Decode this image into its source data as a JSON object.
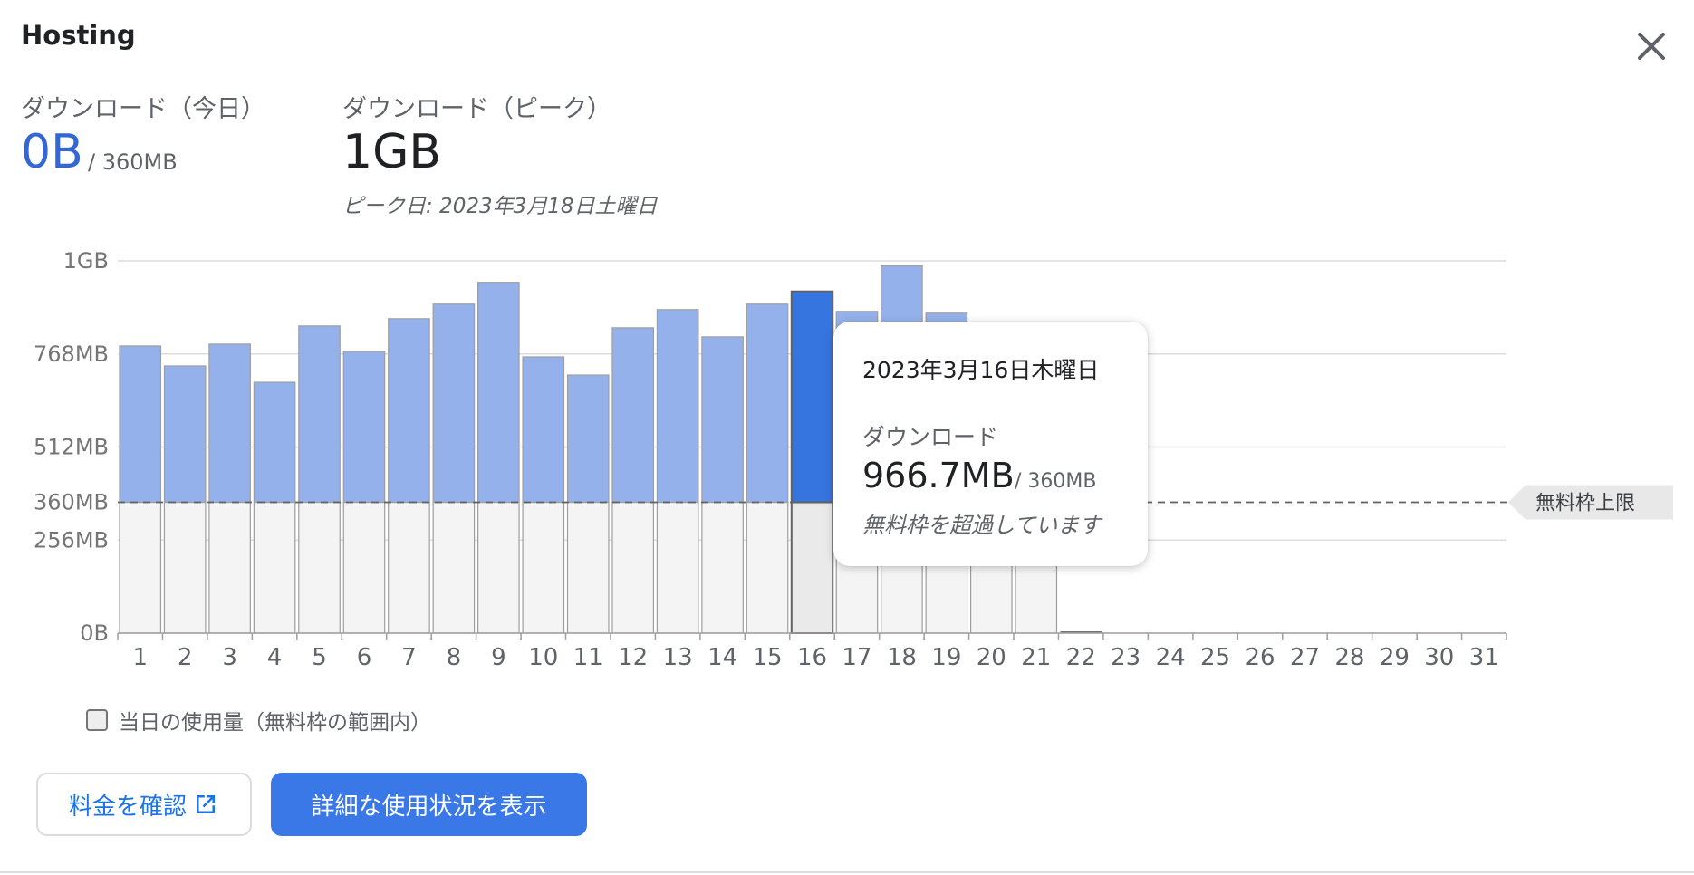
{
  "dialog": {
    "title": "Hosting",
    "close_icon": "close-icon"
  },
  "stats": {
    "today": {
      "label": "ダウンロード（今日）",
      "value": "0B",
      "quota": "/ 360MB",
      "color": "#3367d6"
    },
    "peak": {
      "label": "ダウンロード（ピーク）",
      "value": "1GB",
      "peak_date": "ピーク日: 2023年3月18日土曜日"
    }
  },
  "chart_data": {
    "type": "bar",
    "categories": [
      "1",
      "2",
      "3",
      "4",
      "5",
      "6",
      "7",
      "8",
      "9",
      "10",
      "11",
      "12",
      "13",
      "14",
      "15",
      "16",
      "17",
      "18",
      "19",
      "20",
      "21",
      "22",
      "23",
      "24",
      "25",
      "26",
      "27",
      "28",
      "29",
      "30",
      "31"
    ],
    "unit": "MB",
    "values": [
      790,
      735,
      795,
      690,
      845,
      775,
      865,
      905,
      965,
      760,
      710,
      840,
      890,
      815,
      905,
      940,
      885,
      1010,
      880,
      840,
      780,
      0,
      null,
      null,
      null,
      null,
      null,
      null,
      null,
      null,
      null
    ],
    "y_ticks": [
      {
        "label": "0B",
        "value": 0
      },
      {
        "label": "256MB",
        "value": 256
      },
      {
        "label": "360MB",
        "value": 360
      },
      {
        "label": "512MB",
        "value": 512
      },
      {
        "label": "768MB",
        "value": 768
      },
      {
        "label": "1GB",
        "value": 1024
      }
    ],
    "ylim": [
      0,
      1024
    ],
    "free_limit": 360,
    "free_limit_label": "無料枠上限",
    "highlighted_index": 15,
    "colors": {
      "over_limit": "#94b1eb",
      "over_limit_highlight": "#3674e0",
      "within_limit": "#f4f4f4",
      "within_limit_highlight": "#eaeaea",
      "bar_border": "#9e9e9e",
      "highlight_border": "#616161",
      "gridline": "#dadce0"
    },
    "grid": true
  },
  "tooltip": {
    "date": "2023年3月16日木曜日",
    "label": "ダウンロード",
    "value": "966.7MB",
    "quota": "/ 360MB",
    "note": "無料枠を超過しています"
  },
  "legend": {
    "label": "当日の使用量（無料枠の範囲内）"
  },
  "buttons": {
    "billing_label": "料金を確認",
    "billing_icon": "open-in-new-icon",
    "details_label": "詳細な使用状況を表示",
    "details_color": "#3b78e7"
  }
}
